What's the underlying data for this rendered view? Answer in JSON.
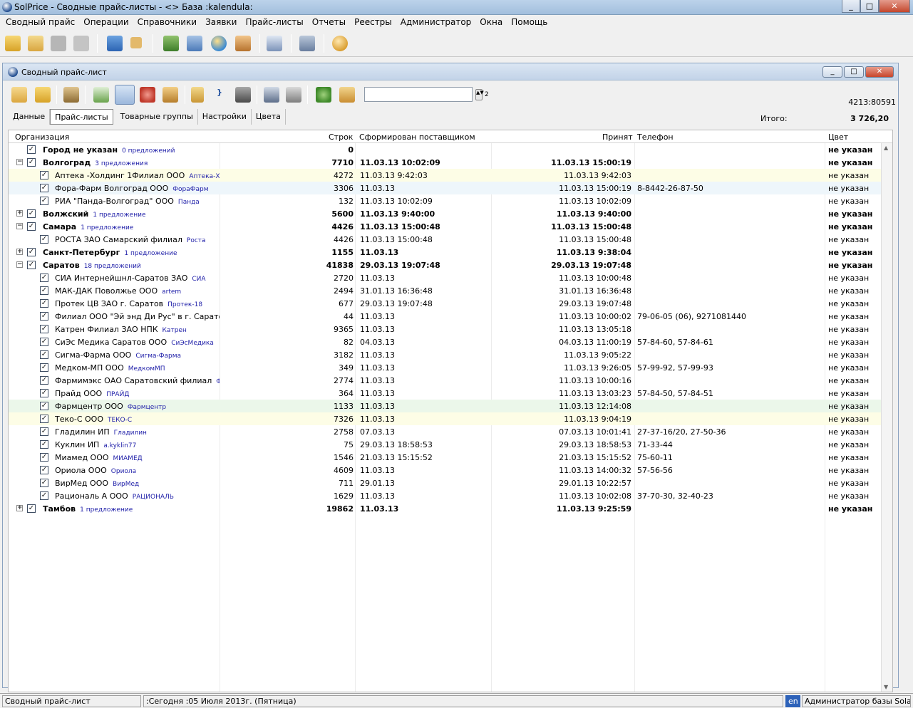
{
  "app": {
    "title": "SolPrice - Сводные прайс-листы - <> База :kalendula:"
  },
  "menu": [
    "Сводный прайс",
    "Операции",
    "Справочники",
    "Заявки",
    "Прайс-листы",
    "Отчеты",
    "Реестры",
    "Администратор",
    "Окна",
    "Помощь"
  ],
  "child": {
    "title": "Сводный прайс-лист",
    "code": "4213:80591",
    "page_count": "2",
    "search_value": ""
  },
  "tabs": [
    {
      "label": "Данные",
      "active": false
    },
    {
      "label": "Прайс-листы",
      "active": true
    },
    {
      "label": "Товарные группы",
      "active": false
    },
    {
      "label": "Настройки",
      "active": false
    },
    {
      "label": "Цвета",
      "active": false
    }
  ],
  "total": {
    "label": "Итого:",
    "value": "3 726,20"
  },
  "columns": {
    "org": "Организация",
    "rows": "Строк",
    "formed": "Сформирован поставщиком",
    "accepted": "Принят",
    "phone": "Телефон",
    "color": "Цвет"
  },
  "rows": [
    {
      "level": 0,
      "expand": "",
      "name": "Город не указан",
      "sub": "0 предложений",
      "rows": "0",
      "formed": "",
      "accepted": "",
      "phone": "",
      "color": "не указан"
    },
    {
      "level": 0,
      "expand": "-",
      "name": "Волгоград",
      "sub": "3 предложения",
      "rows": "7710",
      "formed": "11.03.13 10:02:09",
      "accepted": "11.03.13 15:00:19",
      "phone": "",
      "color": "не указан"
    },
    {
      "level": 1,
      "name": "Аптека -Холдинг 1Филиал ООО",
      "sub": "Аптека-Холдинг",
      "rows": "4272",
      "formed": "11.03.13 9:42:03",
      "accepted": "11.03.13 9:42:03",
      "phone": "",
      "color": "не указан",
      "bg": "#fdfde6"
    },
    {
      "level": 1,
      "name": "Фора-Фарм Волгоград ООО",
      "sub": "ФораФарм",
      "rows": "3306",
      "formed": "11.03.13",
      "accepted": "11.03.13 15:00:19",
      "phone": "8-8442-26-87-50",
      "color": "не указан",
      "bg": "#eef6fb"
    },
    {
      "level": 1,
      "name": "РИА \"Панда-Волгоград\" ООО",
      "sub": "Панда",
      "rows": "132",
      "formed": "11.03.13 10:02:09",
      "accepted": "11.03.13 10:02:09",
      "phone": "",
      "color": "не указан"
    },
    {
      "level": 0,
      "expand": "+",
      "name": "Волжский",
      "sub": "1 предложение",
      "rows": "5600",
      "formed": "11.03.13 9:40:00",
      "accepted": "11.03.13 9:40:00",
      "phone": "",
      "color": "не указан"
    },
    {
      "level": 0,
      "expand": "-",
      "name": "Самара",
      "sub": "1 предложение",
      "rows": "4426",
      "formed": "11.03.13 15:00:48",
      "accepted": "11.03.13 15:00:48",
      "phone": "",
      "color": "не указан"
    },
    {
      "level": 1,
      "name": "РОСТА ЗАО Самарский филиал",
      "sub": "Роста",
      "rows": "4426",
      "formed": "11.03.13 15:00:48",
      "accepted": "11.03.13 15:00:48",
      "phone": "",
      "color": "не указан"
    },
    {
      "level": 0,
      "expand": "+",
      "name": "Санкт-Петербург",
      "sub": "1 предложение",
      "rows": "1155",
      "formed": "11.03.13",
      "accepted": "11.03.13 9:38:04",
      "phone": "",
      "color": "не указан"
    },
    {
      "level": 0,
      "expand": "-",
      "name": "Саратов",
      "sub": "18 предложений",
      "rows": "41838",
      "formed": "29.03.13 19:07:48",
      "accepted": "29.03.13 19:07:48",
      "phone": "",
      "color": "не указан"
    },
    {
      "level": 1,
      "name": "СИА Интернейшнл-Саратов ЗАО",
      "sub": "СИА",
      "rows": "2720",
      "formed": "11.03.13",
      "accepted": "11.03.13 10:00:48",
      "phone": "",
      "color": "не указан"
    },
    {
      "level": 1,
      "name": "МАК-ДАК Поволжье ООО",
      "sub": "artem",
      "rows": "2494",
      "formed": "31.01.13 16:36:48",
      "accepted": "31.01.13 16:36:48",
      "phone": "",
      "color": "не указан"
    },
    {
      "level": 1,
      "name": "Протек ЦВ ЗАО г. Саратов",
      "sub": "Протек-18",
      "rows": "677",
      "formed": "29.03.13 19:07:48",
      "accepted": "29.03.13 19:07:48",
      "phone": "",
      "color": "не указан"
    },
    {
      "level": 1,
      "name": "Филиал ООО \"Эй энд Ди Рус\" в г. Саратове",
      "sub": "Э",
      "rows": "44",
      "formed": "11.03.13",
      "accepted": "11.03.13 10:00:02",
      "phone": "79-06-05 (06), 9271081440",
      "color": "не указан"
    },
    {
      "level": 1,
      "name": "Катрен  Филиал ЗАО НПК",
      "sub": "Катрен",
      "rows": "9365",
      "formed": "11.03.13",
      "accepted": "11.03.13 13:05:18",
      "phone": "",
      "color": "не указан"
    },
    {
      "level": 1,
      "name": "СиЭс Медика Саратов ООО",
      "sub": "СиЭсМедика",
      "rows": "82",
      "formed": "04.03.13",
      "accepted": "04.03.13 11:00:19",
      "phone": "57-84-60, 57-84-61",
      "color": "не указан"
    },
    {
      "level": 1,
      "name": "Сигма-Фарма ООО",
      "sub": "Сигма-Фарма",
      "rows": "3182",
      "formed": "11.03.13",
      "accepted": "11.03.13 9:05:22",
      "phone": "",
      "color": "не указан"
    },
    {
      "level": 1,
      "name": "Медком-МП ООО",
      "sub": "МедкомМП",
      "rows": "349",
      "formed": "11.03.13",
      "accepted": "11.03.13 9:26:05",
      "phone": "57-99-92, 57-99-93",
      "color": "не указан"
    },
    {
      "level": 1,
      "name": "Фармимэкс ОАО Саратовский филиал",
      "sub": "Фармим",
      "rows": "2774",
      "formed": "11.03.13",
      "accepted": "11.03.13 10:00:16",
      "phone": "",
      "color": "не указан"
    },
    {
      "level": 1,
      "name": "Прайд ООО",
      "sub": "ПРАЙД",
      "rows": "364",
      "formed": "11.03.13",
      "accepted": "11.03.13 13:03:23",
      "phone": "57-84-50, 57-84-51",
      "color": "не указан"
    },
    {
      "level": 1,
      "name": "Фармцентр ООО",
      "sub": "Фармцентр",
      "rows": "1133",
      "formed": "11.03.13",
      "accepted": "11.03.13 12:14:08",
      "phone": "",
      "color": "не указан",
      "bg": "#ebf7ea"
    },
    {
      "level": 1,
      "name": "Теко-С ООО",
      "sub": "ТЕКО-С",
      "rows": "7326",
      "formed": "11.03.13",
      "accepted": "11.03.13 9:04:19",
      "phone": "",
      "color": "не указан",
      "bg": "#fdfde6"
    },
    {
      "level": 1,
      "name": "Гладилин ИП",
      "sub": "Гладилин",
      "rows": "2758",
      "formed": "07.03.13",
      "accepted": "07.03.13 10:01:41",
      "phone": "27-37-16/20, 27-50-36",
      "color": "не указан"
    },
    {
      "level": 1,
      "name": "Куклин ИП",
      "sub": "a.kyklin77",
      "rows": "75",
      "formed": "29.03.13 18:58:53",
      "accepted": "29.03.13 18:58:53",
      "phone": "71-33-44",
      "color": "не указан"
    },
    {
      "level": 1,
      "name": "Миамед ООО",
      "sub": "МИАМЕД",
      "rows": "1546",
      "formed": "21.03.13 15:15:52",
      "accepted": "21.03.13 15:15:52",
      "phone": "75-60-11",
      "color": "не указан"
    },
    {
      "level": 1,
      "name": "Ориола ООО",
      "sub": "Ориола",
      "rows": "4609",
      "formed": "11.03.13",
      "accepted": "11.03.13 14:00:32",
      "phone": " 57-56-56",
      "color": "не указан"
    },
    {
      "level": 1,
      "name": "ВирМед ООО",
      "sub": "ВирМед",
      "rows": "711",
      "formed": "29.01.13",
      "accepted": "29.01.13 10:22:57",
      "phone": "",
      "color": "не указан"
    },
    {
      "level": 1,
      "name": "Рациональ А ООО",
      "sub": "РАЦИОНАЛЬ",
      "rows": "1629",
      "formed": "11.03.13",
      "accepted": "11.03.13 10:02:08",
      "phone": "37-70-30, 32-40-23",
      "color": "не указан"
    },
    {
      "level": 0,
      "expand": "+",
      "name": "Тамбов",
      "sub": "1 предложение",
      "rows": "19862",
      "formed": "11.03.13",
      "accepted": "11.03.13 9:25:59",
      "phone": "",
      "color": "не указан"
    }
  ],
  "status": {
    "window": "Сводный прайс-лист",
    "date": ":Сегодня :05 Июля 2013г. (Пятница)",
    "lang": "en",
    "user": "Администратор базы SolarisF"
  }
}
